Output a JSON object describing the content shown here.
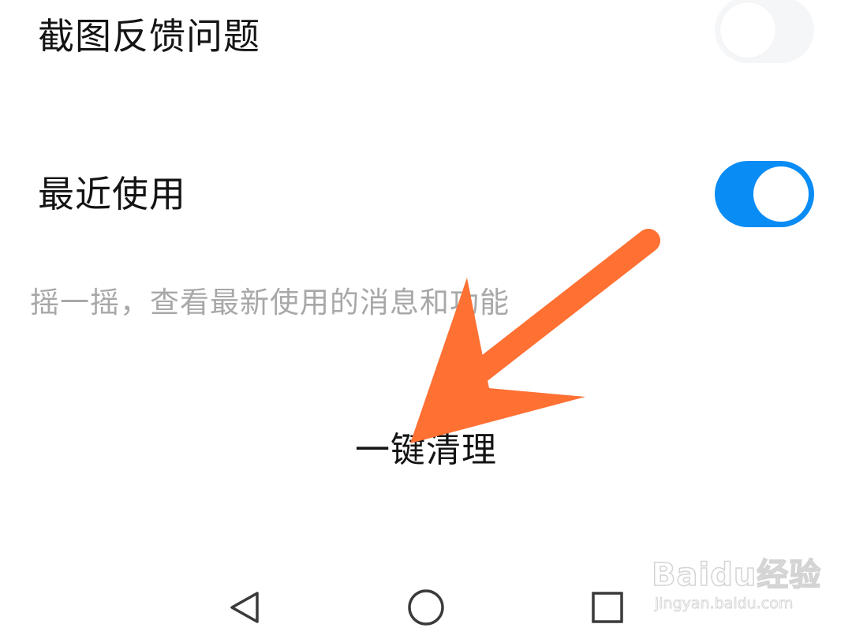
{
  "settings": {
    "screenshot_feedback": {
      "title": "截图反馈问题",
      "enabled": false
    },
    "recent_use": {
      "title": "最近使用",
      "enabled": true,
      "description": "摇一摇，查看最新使用的消息和功能"
    }
  },
  "actions": {
    "clean_label": "一键清理"
  },
  "navbar": {
    "back_icon": "triangle-back-icon",
    "home_icon": "circle-home-icon",
    "recents_icon": "square-recents-icon"
  },
  "annotation": {
    "arrow_color": "#ff7033"
  },
  "watermark": {
    "logo": "Baidu经验",
    "url": "jingyan.baidu.com"
  },
  "colors": {
    "toggle_on": "#0a8cf5",
    "toggle_off": "#f5f6f8",
    "subtitle": "#a8a8a8"
  }
}
